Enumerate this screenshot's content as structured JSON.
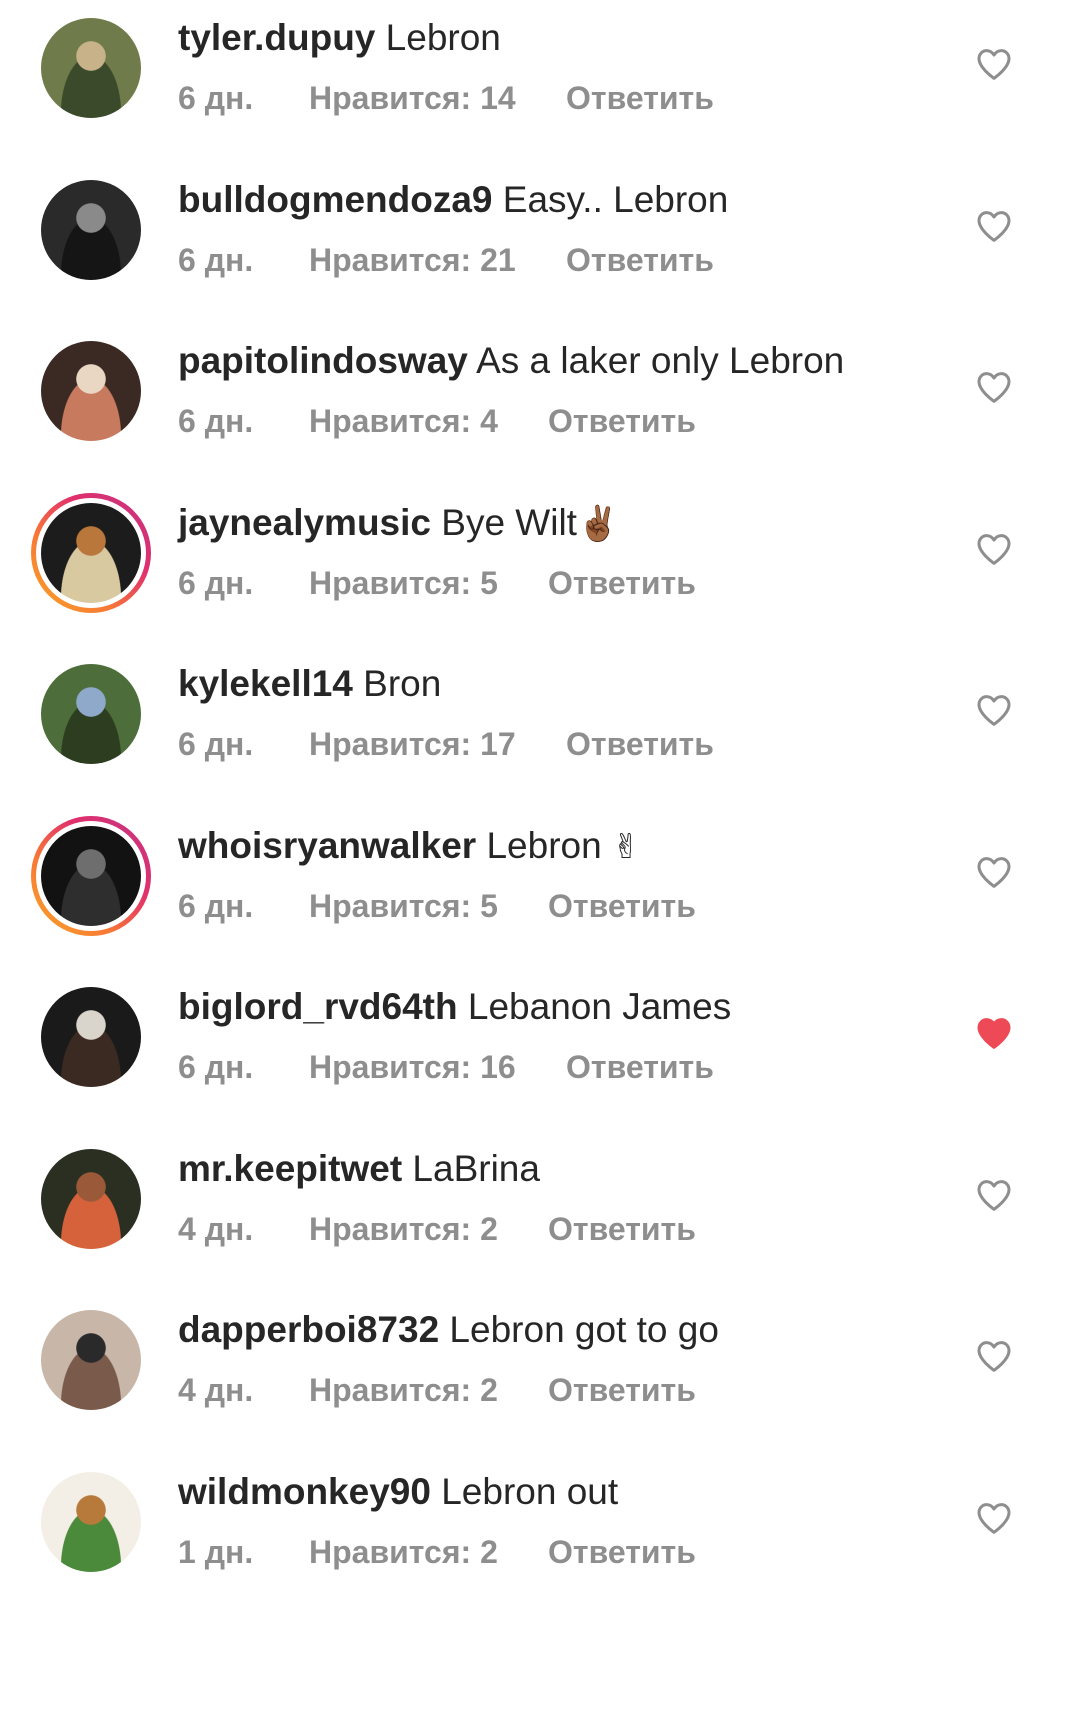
{
  "comments": [
    {
      "username": "tyler.dupuy",
      "text": " Lebron",
      "time": "6 дн.",
      "likes": "Нравится: 14",
      "reply": "Ответить",
      "liked": false,
      "story": false,
      "avatar_colors": [
        "#6f7b4a",
        "#c8b28a",
        "#3a4a2a"
      ]
    },
    {
      "username": "bulldogmendoza9",
      "text": " Easy.. Lebron",
      "time": "6 дн.",
      "likes": "Нравится: 21",
      "reply": "Ответить",
      "liked": false,
      "story": false,
      "avatar_colors": [
        "#2a2a2a",
        "#8a8a8a",
        "#151515"
      ]
    },
    {
      "username": "papitolindosway",
      "text": " As a laker only Lebron",
      "time": "6 дн.",
      "likes": "Нравится: 4",
      "reply": "Ответить",
      "liked": false,
      "story": false,
      "avatar_colors": [
        "#3b2a24",
        "#e9d7c4",
        "#c77a5e"
      ]
    },
    {
      "username": "jaynealymusic",
      "text": " Bye Wilt",
      "emoji": "✌🏾",
      "time": "6 дн.",
      "likes": "Нравится: 5",
      "reply": "Ответить",
      "liked": false,
      "story": true,
      "avatar_colors": [
        "#1c1c1c",
        "#b9773c",
        "#d9c9a0"
      ]
    },
    {
      "username": "kylekell14",
      "text": " Bron",
      "time": "6 дн.",
      "likes": "Нравится: 17",
      "reply": "Ответить",
      "liked": false,
      "story": false,
      "avatar_colors": [
        "#4d6e3a",
        "#8ea9c9",
        "#2c3e1f"
      ]
    },
    {
      "username": "whoisryanwalker",
      "text": " Lebron ",
      "emoji": "✌",
      "time": "6 дн.",
      "likes": "Нравится: 5",
      "reply": "Ответить",
      "liked": false,
      "story": true,
      "avatar_colors": [
        "#121212",
        "#6e6e6e",
        "#2e2e2e"
      ]
    },
    {
      "username": "biglord_rvd64th",
      "text": " Lebanon James",
      "time": "6 дн.",
      "likes": "Нравится: 16",
      "reply": "Ответить",
      "liked": true,
      "story": false,
      "avatar_colors": [
        "#1a1a1a",
        "#d9d4cc",
        "#3a2a22"
      ]
    },
    {
      "username": "mr.keepitwet",
      "text": " LaBrina",
      "time": "4 дн.",
      "likes": "Нравится: 2",
      "reply": "Ответить",
      "liked": false,
      "story": false,
      "avatar_colors": [
        "#2a2f22",
        "#9a5a3a",
        "#d5623a"
      ]
    },
    {
      "username": "dapperboi8732",
      "text": " Lebron got to go",
      "time": "4 дн.",
      "likes": "Нравится: 2",
      "reply": "Ответить",
      "liked": false,
      "story": false,
      "avatar_colors": [
        "#c8b6a8",
        "#2a2a2a",
        "#7a5a4a"
      ]
    },
    {
      "username": "wildmonkey90",
      "text": " Lebron out",
      "time": "1 дн.",
      "likes": "Нравится: 2",
      "reply": "Ответить",
      "liked": false,
      "story": false,
      "avatar_colors": [
        "#f4efe6",
        "#b87a3a",
        "#4a8a3a"
      ]
    }
  ],
  "colors": {
    "text": "#262626",
    "meta": "#8e8e8e",
    "heart_outline": "#8e8e8e",
    "heart_liked": "#ed4956"
  },
  "icons": {
    "heart": "heart-icon",
    "heart_filled": "heart-filled-icon"
  }
}
